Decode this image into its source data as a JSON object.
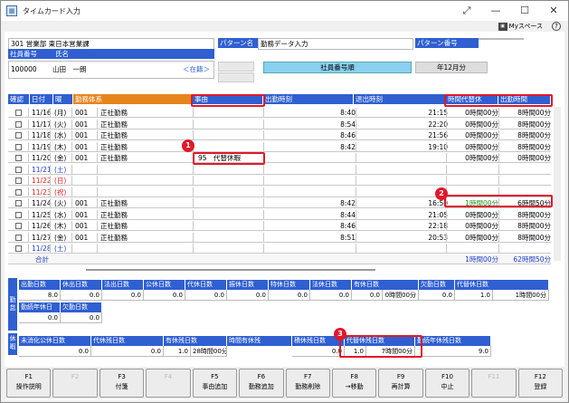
{
  "window": {
    "title": "タイムカード入力",
    "icon": "app-icon"
  },
  "topbar": {
    "myspace": "Myスペース",
    "help": "?"
  },
  "employee": {
    "dept": "301 営業部 東日本営業課",
    "id_label": "社員番号",
    "name_label": "氏名",
    "id": "100000",
    "name": "山田　一朗",
    "status": "＜在籍＞"
  },
  "pattern": {
    "name_label": "パターン名",
    "name": "勤務データ入力",
    "no_label": "パターン番号",
    "no": ""
  },
  "sort": {
    "order": "社員番号順",
    "period": "年12月分"
  },
  "columns": {
    "confirm": "確認",
    "date": "日付",
    "dow": "曜",
    "work_type": "勤務体系",
    "reason": "事由",
    "in_time": "出勤時刻",
    "out_time": "退出時刻",
    "comp_leave": "時間代替休",
    "work_hours": "出勤時間"
  },
  "rows": [
    {
      "date": "11/16",
      "dow": "(月)",
      "dc": "",
      "code": "001",
      "type": "正社勤務",
      "reason": "",
      "in": "8:40",
      "out": "21:15",
      "comp": "0時間00分",
      "hours": "8時間00分"
    },
    {
      "date": "11/17",
      "dow": "(火)",
      "dc": "",
      "code": "001",
      "type": "正社勤務",
      "reason": "",
      "in": "8:54",
      "out": "22:20",
      "comp": "0時間00分",
      "hours": "8時間00分"
    },
    {
      "date": "11/18",
      "dow": "(水)",
      "dc": "",
      "code": "001",
      "type": "正社勤務",
      "reason": "",
      "in": "8:46",
      "out": "21:56",
      "comp": "0時間00分",
      "hours": "8時間00分"
    },
    {
      "date": "11/19",
      "dow": "(木)",
      "dc": "",
      "code": "001",
      "type": "正社勤務",
      "reason": "",
      "in": "8:42",
      "out": "19:10",
      "comp": "0時間00分",
      "hours": "8時間00分"
    },
    {
      "date": "11/20",
      "dow": "(金)",
      "dc": "",
      "code": "001",
      "type": "正社勤務",
      "reason": "95　代替休暇",
      "in": "",
      "out": "",
      "comp": "0時間00分",
      "hours": "0時間00分"
    },
    {
      "date": "11/21",
      "dow": "(土)",
      "dc": "sat",
      "code": "",
      "type": "",
      "reason": "",
      "in": "",
      "out": "",
      "comp": "",
      "hours": ""
    },
    {
      "date": "11/22",
      "dow": "(日)",
      "dc": "hol",
      "code": "",
      "type": "",
      "reason": "",
      "in": "",
      "out": "",
      "comp": "",
      "hours": ""
    },
    {
      "date": "11/23",
      "dow": "(祝)",
      "dc": "hol",
      "code": "",
      "type": "",
      "reason": "",
      "in": "",
      "out": "",
      "comp": "",
      "hours": ""
    },
    {
      "date": "11/24",
      "dow": "(火)",
      "dc": "",
      "code": "001",
      "type": "正社勤務",
      "reason": "",
      "in": "8:42",
      "out": "16:50",
      "comp": "1時間00分",
      "hours": "6時間50分"
    },
    {
      "date": "11/25",
      "dow": "(水)",
      "dc": "",
      "code": "001",
      "type": "正社勤務",
      "reason": "",
      "in": "8:44",
      "out": "21:05",
      "comp": "0時間00分",
      "hours": "8時間00分"
    },
    {
      "date": "11/26",
      "dow": "(木)",
      "dc": "",
      "code": "001",
      "type": "正社勤務",
      "reason": "",
      "in": "8:46",
      "out": "22:18",
      "comp": "0時間00分",
      "hours": "8時間00分"
    },
    {
      "date": "11/27",
      "dow": "(金)",
      "dc": "",
      "code": "001",
      "type": "正社勤務",
      "reason": "",
      "in": "8:51",
      "out": "20:53",
      "comp": "0時間00分",
      "hours": "8時間00分"
    },
    {
      "date": "11/28",
      "dow": "(土)",
      "dc": "sat",
      "code": "",
      "type": "",
      "reason": "",
      "in": "",
      "out": "",
      "comp": "",
      "hours": ""
    }
  ],
  "total": {
    "label": "合計",
    "comp": "1時間00分",
    "hours": "62時間50分"
  },
  "days": {
    "side": "勤怠",
    "labels": [
      "出勤日数",
      "休出日数",
      "法出日数",
      "公休日数",
      "代休日数",
      "振休日数",
      "特休日数",
      "法休日数",
      "有休日数",
      "",
      "欠勤日数",
      "代替休日数"
    ],
    "values": [
      "8.0",
      "0.0",
      "0.0",
      "0.0",
      "0.0",
      "0.0",
      "0.0",
      "0.0",
      "0.0",
      "0時間00分",
      "0.0",
      "1.0",
      "1時間00分"
    ],
    "labels2": [
      "勤続年休日",
      "欠勤日数"
    ],
    "values2": [
      "0.0",
      "0.0"
    ]
  },
  "remain": {
    "side": "休暇",
    "labels": [
      "未消化公休日数",
      "代休残日数",
      "有休残日数",
      "時間有休残",
      "積休残日数",
      "代替休残日数",
      "勤続年休残日数"
    ],
    "values": [
      "0.0",
      "0.0",
      "1.0",
      "28時間00分",
      "0.0",
      "1.0",
      "7時間00分",
      "9.0"
    ]
  },
  "fkeys": [
    {
      "k": "F1",
      "l": "操作説明",
      "d": false
    },
    {
      "k": "F2",
      "l": "",
      "d": true
    },
    {
      "k": "F3",
      "l": "付箋",
      "d": false
    },
    {
      "k": "F4",
      "l": "",
      "d": true
    },
    {
      "k": "F5",
      "l": "事由追加",
      "d": false
    },
    {
      "k": "F6",
      "l": "勤務追加",
      "d": false
    },
    {
      "k": "F7",
      "l": "勤務削除",
      "d": false
    },
    {
      "k": "F8",
      "l": "→移動",
      "d": false
    },
    {
      "k": "F9",
      "l": "再計算",
      "d": false
    },
    {
      "k": "F10",
      "l": "中止",
      "d": false
    },
    {
      "k": "F11",
      "l": "",
      "d": true
    },
    {
      "k": "F12",
      "l": "登録",
      "d": false
    }
  ],
  "badges": [
    "1",
    "2",
    "3"
  ]
}
